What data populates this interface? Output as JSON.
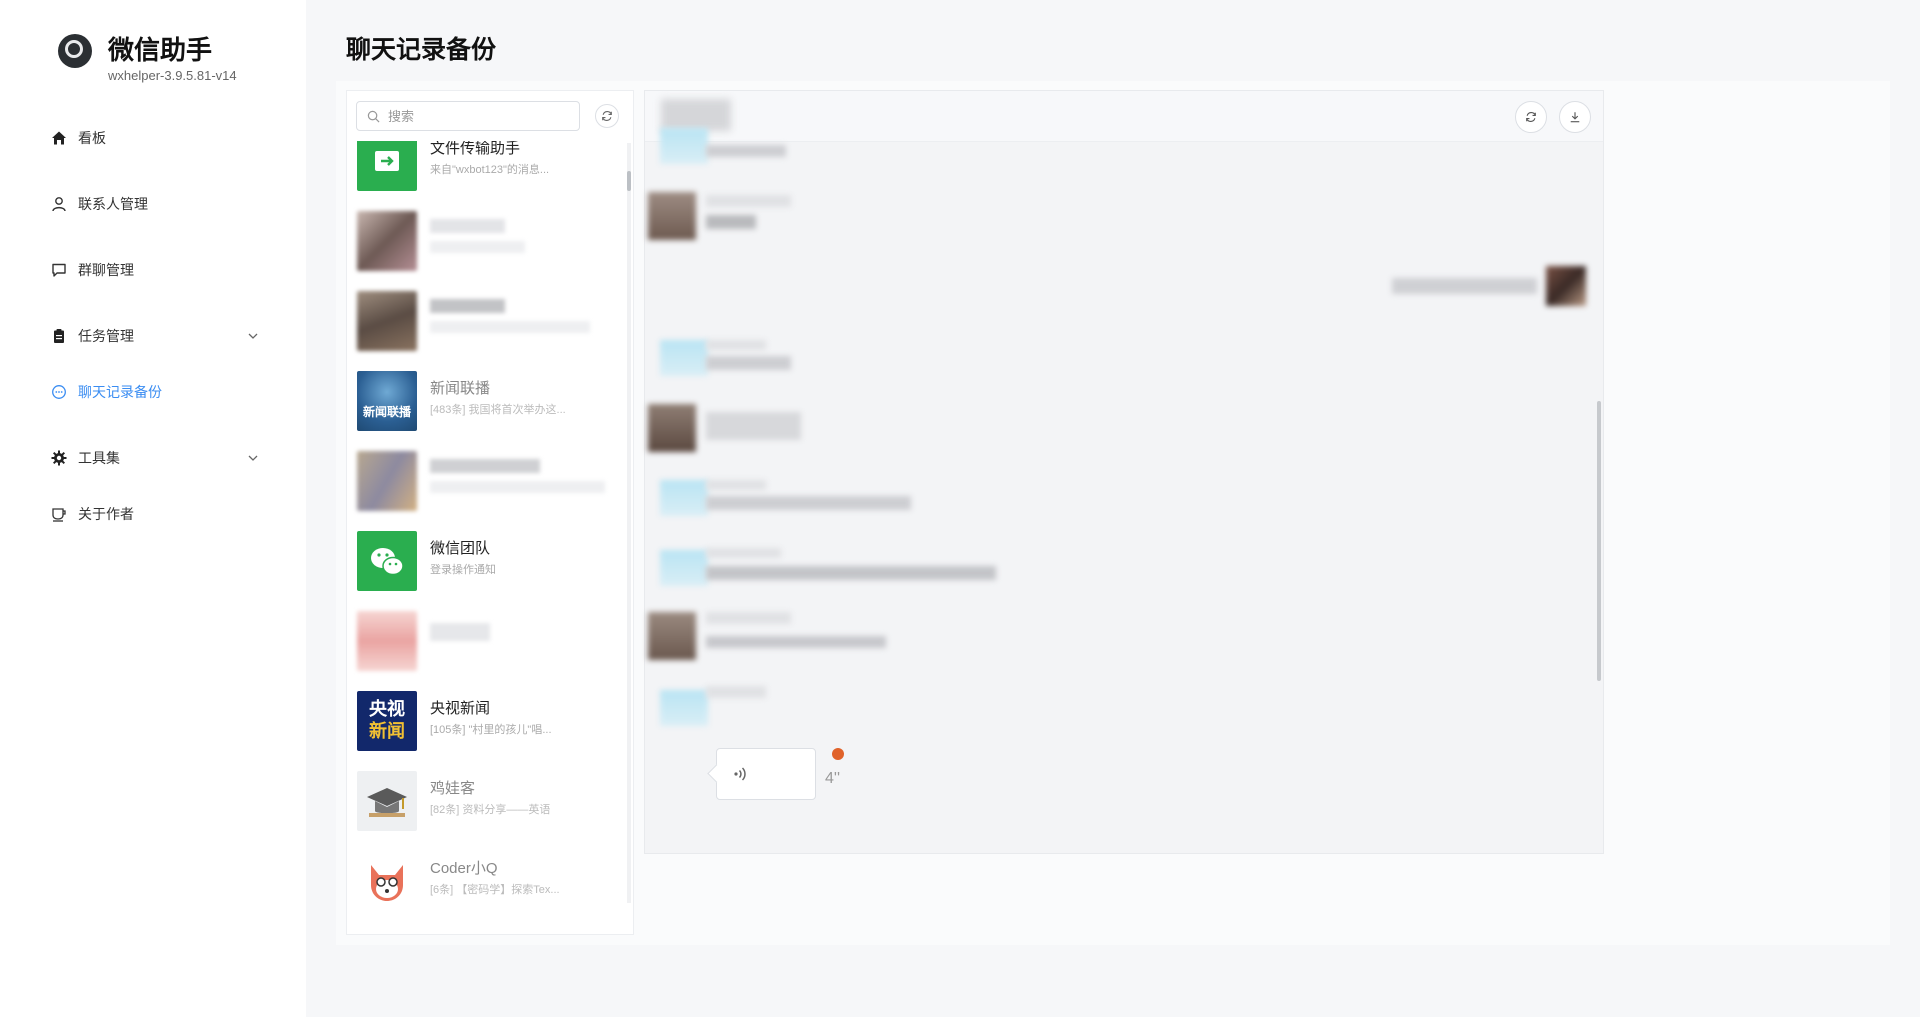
{
  "app": {
    "name": "微信助手",
    "version": "wxhelper-3.9.5.81-v14"
  },
  "nav": [
    {
      "label": "看板",
      "icon": "home-icon"
    },
    {
      "label": "联系人管理",
      "icon": "user-icon"
    },
    {
      "label": "群聊管理",
      "icon": "message-square-icon"
    },
    {
      "label": "任务管理",
      "icon": "clipboard-icon"
    },
    {
      "label": "聊天记录备份",
      "icon": "chat-bubble-icon",
      "active": true
    },
    {
      "label": "工具集",
      "icon": "gear-icon"
    },
    {
      "label": "关于作者",
      "icon": "coffee-cup-icon"
    }
  ],
  "page": {
    "title": "聊天记录备份"
  },
  "search": {
    "placeholder": "搜索"
  },
  "contacts": [
    {
      "name": "文件传输助手",
      "preview": "来自\"wxbot123\"的消息..."
    },
    {
      "name": "",
      "preview": ""
    },
    {
      "name": "",
      "preview": ""
    },
    {
      "name": "新闻联播",
      "preview": "[483条] 我国将首次举办这..."
    },
    {
      "name": "",
      "preview": ""
    },
    {
      "name": "微信团队",
      "preview": "登录操作通知"
    },
    {
      "name": "",
      "preview": ""
    },
    {
      "name": "央视新闻",
      "preview": "[105条] \"村里的孩儿\"唱..."
    },
    {
      "name": "鸡娃客",
      "preview": "[82条] 资料分享——英语"
    },
    {
      "name": "Coder小Q",
      "preview": "[6条] 【密码学】探索Tex..."
    }
  ],
  "avatars": {
    "news_broadcast_text": "新闻联播",
    "cctv_news_text_1": "央视",
    "cctv_news_text_2": "新闻"
  },
  "chat": {
    "voice_duration": "4''"
  },
  "colors": {
    "accent": "#3b8df2",
    "wechat_green": "#2aae4f",
    "unread_dot": "#e0622a"
  }
}
